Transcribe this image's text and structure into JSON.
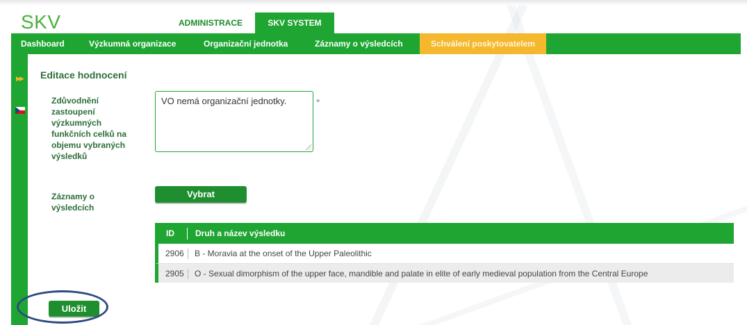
{
  "header": {
    "logo": "SKV",
    "tabs": [
      {
        "label": "ADMINISTRACE",
        "active": false
      },
      {
        "label": "SKV SYSTEM",
        "active": true
      }
    ]
  },
  "nav": {
    "items": [
      {
        "label": "Dashboard"
      },
      {
        "label": "Výzkumná organizace"
      },
      {
        "label": "Organizační jednotka"
      },
      {
        "label": "Záznamy o výsledcích"
      },
      {
        "label": "Schválení poskytovatelem",
        "active": true
      }
    ]
  },
  "left_strip": {
    "expand_icon": "double-chevron-right",
    "language_flag": "czech-flag"
  },
  "form": {
    "title": "Editace hodnocení",
    "justification": {
      "label": "Zdůvodnění\nzastoupení\nvýzkumných\nfunkčních celků na\nobjemu vybraných\nvýsledků",
      "value": "VO nemá organizační jednotky.",
      "required_mark": "*"
    },
    "records": {
      "label": "Záznamy o\nvýsledcích",
      "select_button": "Vybrat"
    },
    "save_button": "Uložit"
  },
  "results_table": {
    "columns": [
      "ID",
      "Druh a název výsledku"
    ],
    "rows": [
      {
        "id": "2906",
        "name": "B - Moravia at the onset of the Upper Paleolithic"
      },
      {
        "id": "2905",
        "name": "O - Sexual dimorphism of the upper face, mandible and palate in elite of early medieval population from the Central Europe"
      }
    ]
  },
  "colors": {
    "primary_green": "#1fa532",
    "active_nav": "#f5b72e",
    "annotation_ellipse": "#2c4a82"
  }
}
